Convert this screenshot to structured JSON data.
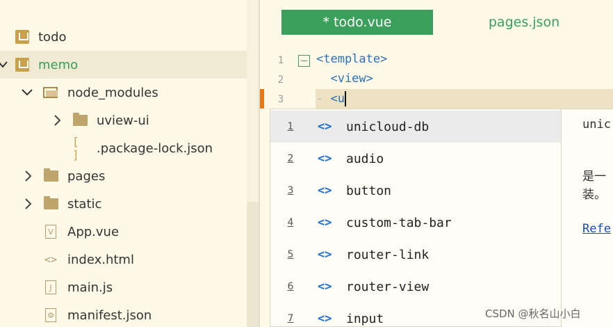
{
  "file_tree": {
    "items": [
      {
        "label": "todo",
        "icon": "project-icon",
        "chevron": "none"
      },
      {
        "label": "memo",
        "icon": "project-icon",
        "chevron": "expanded",
        "selected": true
      },
      {
        "label": "node_modules",
        "icon": "folder-open-icon",
        "chevron": "expanded"
      },
      {
        "label": "uview-ui",
        "icon": "folder-icon",
        "chevron": "collapsed"
      },
      {
        "label": ".package-lock.json",
        "icon": "json-bracket-icon",
        "chevron": "none"
      },
      {
        "label": "pages",
        "icon": "folder-icon",
        "chevron": "collapsed"
      },
      {
        "label": "static",
        "icon": "folder-icon",
        "chevron": "collapsed"
      },
      {
        "label": "App.vue",
        "icon": "vue-file-icon",
        "chevron": "none"
      },
      {
        "label": "index.html",
        "icon": "html-file-icon",
        "chevron": "none"
      },
      {
        "label": "main.js",
        "icon": "js-file-icon",
        "chevron": "none"
      },
      {
        "label": "manifest.json",
        "icon": "settings-json-icon",
        "chevron": "none"
      }
    ]
  },
  "tabs": [
    {
      "label": "* todo.vue",
      "active": true
    },
    {
      "label": "pages.json",
      "active": false
    }
  ],
  "editor": {
    "line_numbers": [
      "1",
      "2",
      "3"
    ],
    "lines": [
      "<template>",
      "  <view>",
      "<u"
    ]
  },
  "autocomplete": {
    "items": [
      {
        "num": "1",
        "icon": "<>",
        "label": "unicloud-db"
      },
      {
        "num": "2",
        "icon": "<>",
        "label": "audio"
      },
      {
        "num": "3",
        "icon": "<>",
        "label": "button"
      },
      {
        "num": "4",
        "icon": "<>",
        "label": "custom-tab-bar"
      },
      {
        "num": "5",
        "icon": "<>",
        "label": "router-link"
      },
      {
        "num": "6",
        "icon": "<>",
        "label": "router-view"
      },
      {
        "num": "7",
        "icon": "<>",
        "label": "input"
      }
    ]
  },
  "doc_panel": {
    "title": "unic",
    "desc": "是一\n装。",
    "link": "Refe"
  },
  "watermark": "CSDN @秋名山小白",
  "colors": {
    "accent_green": "#3aa05b",
    "tag_blue": "#2d6fb8",
    "background": "#fffae8"
  }
}
